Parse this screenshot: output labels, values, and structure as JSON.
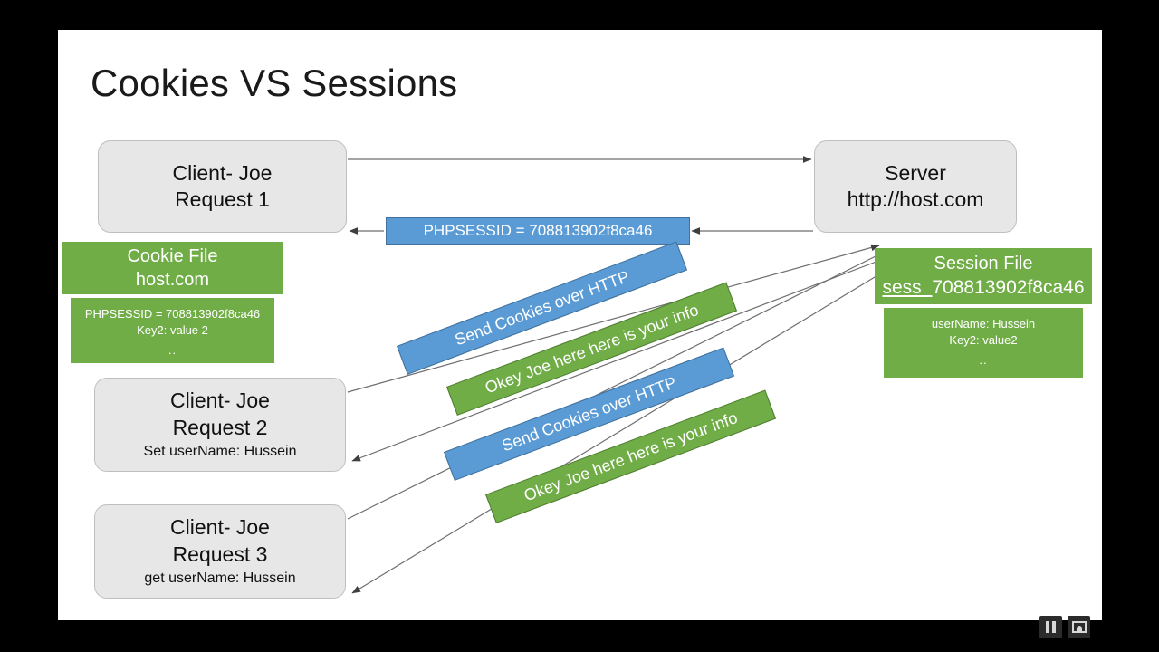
{
  "slide": {
    "title": "Cookies VS Sessions"
  },
  "nodes": {
    "client1": {
      "line1": "Client- Joe",
      "line2": "Request 1"
    },
    "client2": {
      "line1": "Client- Joe",
      "line2": "Request 2",
      "line3": "Set userName: Hussein"
    },
    "client3": {
      "line1": "Client- Joe",
      "line2": "Request 3",
      "line3": "get userName: Hussein"
    },
    "server": {
      "line1": "Server",
      "line2": "http://host.com"
    }
  },
  "cookie_file": {
    "head_line1": "Cookie File",
    "head_line2": "host.com",
    "body_line1": "PHPSESSID = 708813902f8ca46",
    "body_line2": "Key2: value 2",
    "body_line3": ".."
  },
  "session_file": {
    "head_line1": "Session File",
    "head_prefix": "sess_",
    "head_id": "708813902f8ca46",
    "body_line1": "userName: Hussein",
    "body_line2": "Key2: value2",
    "body_line3": ".."
  },
  "banners": {
    "sessid": "PHPSESSID = 708813902f8ca46",
    "ribbon1": "Send Cookies over HTTP",
    "ribbon2": "Okey Joe here here is your info",
    "ribbon3": "Send Cookies over HTTP",
    "ribbon4": "Okey Joe here here is your info"
  },
  "colors": {
    "green": "#70AD47",
    "blue": "#5B9BD5",
    "blue_border": "#41719C",
    "node_fill": "#E7E7E7",
    "node_border": "#BFBFBF",
    "canvas": "#FFFFFF",
    "letterbox": "#000000"
  },
  "controls": {
    "pause_label": "pause",
    "pip_label": "picture-in-picture"
  }
}
